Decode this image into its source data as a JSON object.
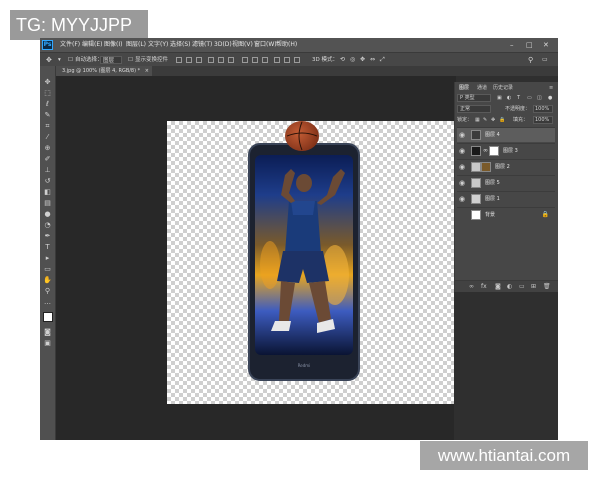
{
  "watermark_top": "TG: MYYJJPP",
  "watermark_bottom": "www.htiantai.com",
  "app": {
    "logo": "Ps",
    "menus": [
      "文件(F)",
      "编辑(E)",
      "图像(I)",
      "图层(L)",
      "文字(Y)",
      "选择(S)",
      "滤镜(T)",
      "3D(D)",
      "视图(V)",
      "窗口(W)",
      "帮助(H)"
    ],
    "window_controls": {
      "minimize": "–",
      "maximize": "□",
      "close": "✕"
    }
  },
  "options_bar": {
    "auto_select_label": "自动选择：",
    "auto_select_value": "图层",
    "transform_label": "显示变换控件",
    "mode_3d": "3D 模式："
  },
  "document_tab": {
    "title": "3.jpg @ 100% (图层 4, RGB/8) *",
    "close": "×"
  },
  "tools": [
    "move-tool",
    "marquee-tool",
    "lasso-tool",
    "magic-wand-tool",
    "crop-tool",
    "eyedropper-tool",
    "healing-brush-tool",
    "brush-tool",
    "clone-stamp-tool",
    "history-brush-tool",
    "eraser-tool",
    "gradient-tool",
    "blur-tool",
    "dodge-tool",
    "pen-tool",
    "type-tool",
    "path-selection-tool",
    "shape-tool",
    "hand-tool",
    "zoom-tool",
    "more-tools"
  ],
  "canvas": {
    "phone_brand": "Redmi"
  },
  "layers_panel": {
    "tabs": [
      "图层",
      "通道",
      "历史记录"
    ],
    "filter_label": "P 类型",
    "blend_mode": "正常",
    "opacity_label": "不透明度：",
    "opacity_value": "100%",
    "lock_label": "锁定：",
    "fill_label": "填充：",
    "fill_value": "100%",
    "layers": [
      {
        "name": "图层 4",
        "selected": true,
        "thumb_color": "#3c3c3c"
      },
      {
        "name": "图层 3",
        "selected": false,
        "thumb_color": "#1a1a1a"
      },
      {
        "name": "图层 2",
        "selected": false,
        "thumb_color": "#7a5a2a"
      },
      {
        "name": "图层 5",
        "selected": false,
        "thumb_color": "#c8c8c8"
      },
      {
        "name": "图层 1",
        "selected": false,
        "thumb_color": "#d0d0d0"
      },
      {
        "name": "背景",
        "selected": false,
        "thumb_color": "#ffffff",
        "locked": true
      }
    ],
    "footer_icons": [
      "link-icon",
      "fx-icon",
      "mask-icon",
      "adjustment-icon",
      "folder-icon",
      "new-layer-icon",
      "trash-icon"
    ]
  }
}
